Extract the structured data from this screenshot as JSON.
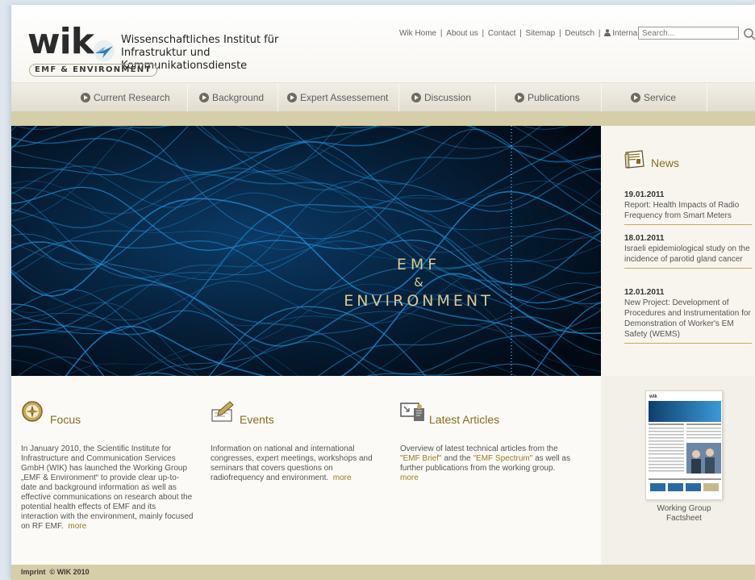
{
  "header": {
    "logo_text": "wik",
    "institute_line1": "Wissenschaftliches Institut für",
    "institute_line2": "Infrastruktur und Kommunikationsdienste",
    "logo_subtitle": "EMF & ENVIRONMENT",
    "toplinks": [
      "Wik Home",
      "About us",
      "Contact",
      "Sitemap",
      "Deutsch"
    ],
    "internal_label": "Internal",
    "search_placeholder": "Search..."
  },
  "nav": {
    "items": [
      "Current Research",
      "Background",
      "Expert Assessement",
      "Discussion",
      "Publications",
      "Service"
    ]
  },
  "hero": {
    "line1": "EMF",
    "line2": "&",
    "line3": "ENVIRONMENT"
  },
  "news": {
    "title": "News",
    "items": [
      {
        "date": "19.01.2011",
        "text": "Report: Health Impacts of Radio Frequency from Smart Meters"
      },
      {
        "date": "18.01.2011",
        "text": "Israeli epidemiological study on the incidence of parotid gland cancer"
      },
      {
        "date": "12.01.2011",
        "text": "New Project: Development of Procedures and Instrumentation for Demonstration of Worker's EM Safety (WEMS)"
      }
    ]
  },
  "focus": {
    "title": "Focus",
    "text": "In January 2010, the Scientific Institute for Infrastructure and Communication Services GmbH (WIK) has launched the Working Group „EMF & Environment“ to provide clear up-to-date and background information as well as effective communications on research about the potential health effects of EMF and its interaction with the environment, mainly focused on RF EMF.",
    "more": "more"
  },
  "events": {
    "title": "Events",
    "text": "Information on national and international congresses, expert meetings, workshops and seminars that covers questions on radiofrequency and environment.",
    "more": "more"
  },
  "articles": {
    "title": "Latest Articles",
    "text_before": "Overview of latest technical articles from the",
    "brief": "\"EMF Brief\"",
    "and": "and the",
    "spectrum": "\"EMF Spectrum\"",
    "text_after": "as well as further publications from the working group.",
    "more": "more"
  },
  "factsheet": {
    "caption_line1": "Working Group",
    "caption_line2": "Factsheet"
  },
  "footer": {
    "imprint": "Imprint",
    "copyright": "© WIK 2010"
  },
  "colors": {
    "accent_gold": "#8a6d1c",
    "tan_bar": "#d6cda9",
    "hero_bg": "#02101c",
    "wave_blue": "#1e8fd8"
  }
}
